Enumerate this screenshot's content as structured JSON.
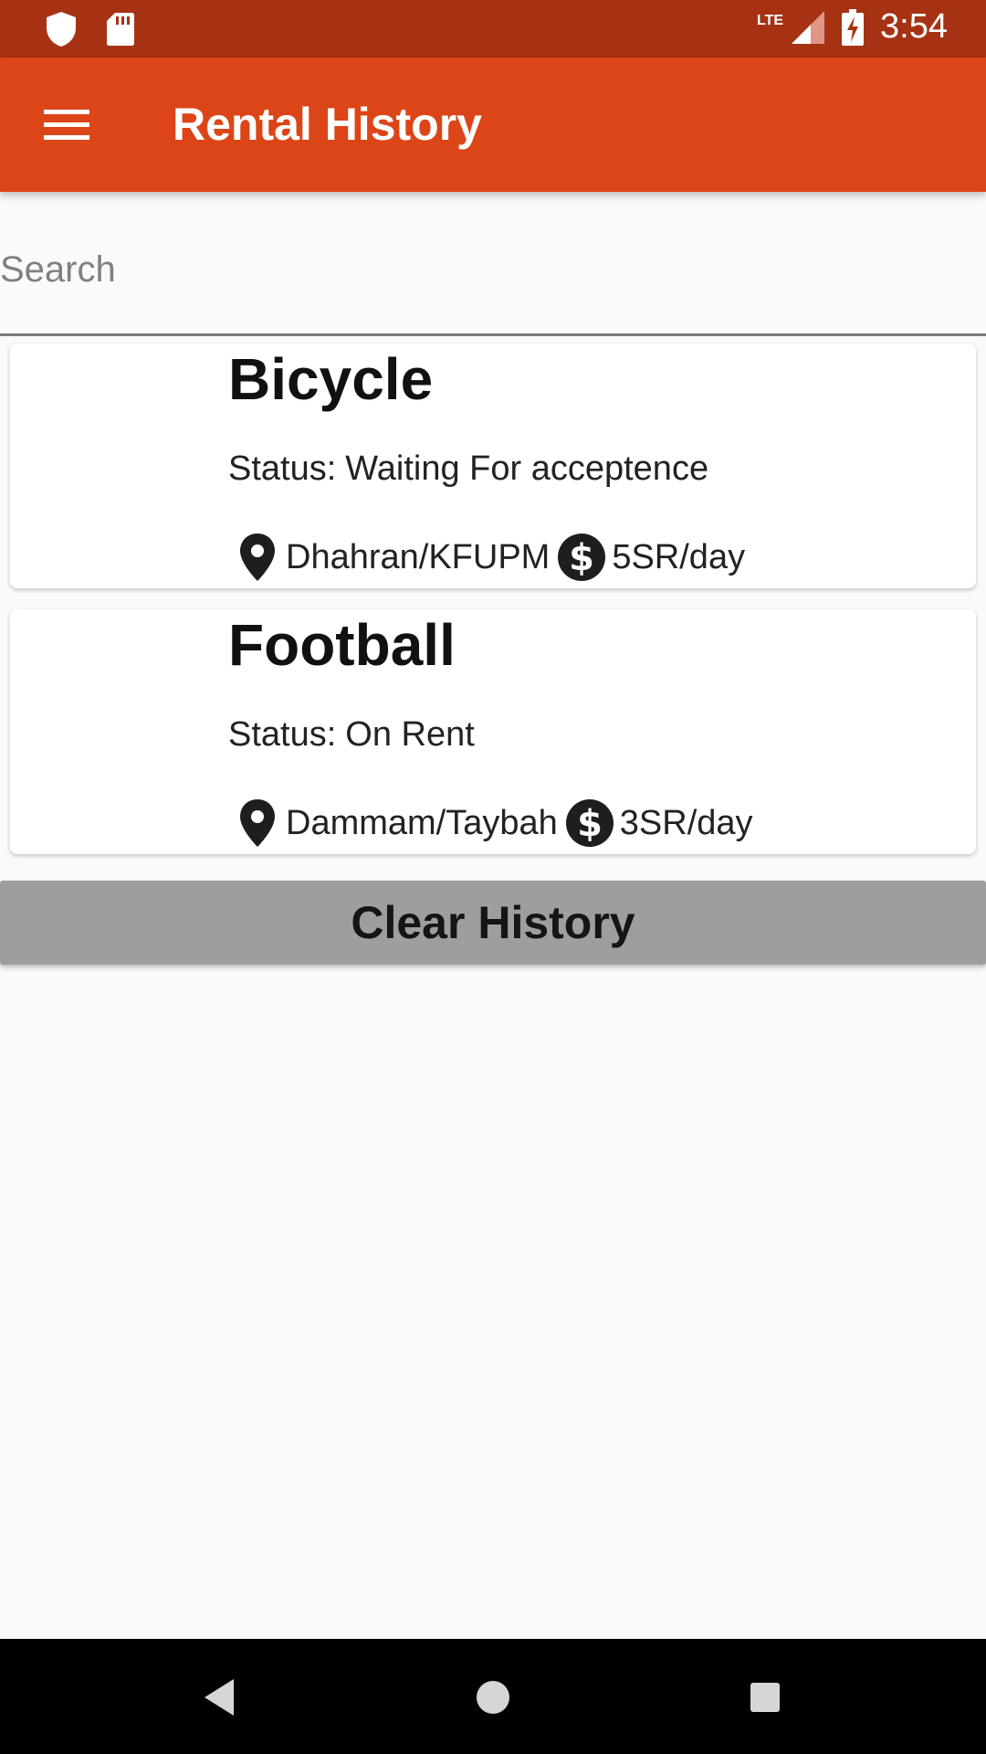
{
  "status_bar": {
    "time": "3:54",
    "network": "LTE"
  },
  "app_bar": {
    "title": "Rental History"
  },
  "search": {
    "placeholder": "Search",
    "value": ""
  },
  "rentals": [
    {
      "name": "Bicycle",
      "status_prefix": "Status:",
      "status": "Waiting For acceptence",
      "location": "Dhahran/KFUPM",
      "price": "5SR/day"
    },
    {
      "name": "Football",
      "status_prefix": "Status:",
      "status": "On Rent",
      "location": "Dammam/Taybah",
      "price": "3SR/day"
    }
  ],
  "actions": {
    "clear_label": "Clear History"
  },
  "colors": {
    "status_bar": "#a63213",
    "app_bar": "#dc4517",
    "button": "#9e9e9e"
  }
}
